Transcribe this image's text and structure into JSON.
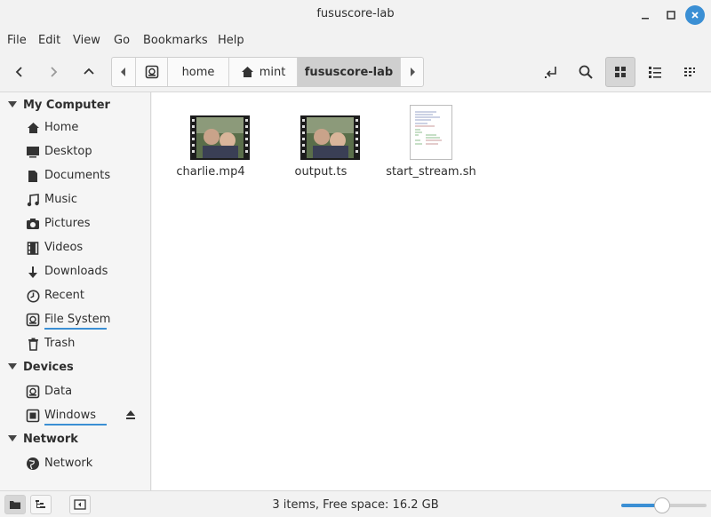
{
  "window": {
    "title": "fususcore-lab"
  },
  "menu": [
    "File",
    "Edit",
    "View",
    "Go",
    "Bookmarks",
    "Help"
  ],
  "breadcrumbs": [
    {
      "label": ""
    },
    {
      "label": "home"
    },
    {
      "label": "mint"
    },
    {
      "label": "fususcore-lab"
    }
  ],
  "sidebar": {
    "sections": [
      {
        "label": "My Computer"
      },
      {
        "label": "Devices"
      },
      {
        "label": "Network"
      }
    ],
    "items": [
      {
        "label": "Home",
        "icon": "home-icon"
      },
      {
        "label": "Desktop",
        "icon": "desktop-icon"
      },
      {
        "label": "Documents",
        "icon": "document-icon"
      },
      {
        "label": "Music",
        "icon": "music-icon"
      },
      {
        "label": "Pictures",
        "icon": "camera-icon"
      },
      {
        "label": "Videos",
        "icon": "film-icon"
      },
      {
        "label": "Downloads",
        "icon": "download-icon"
      },
      {
        "label": "Recent",
        "icon": "clock-icon"
      },
      {
        "label": "File System",
        "icon": "drive-icon"
      },
      {
        "label": "Trash",
        "icon": "trash-icon"
      },
      {
        "label": "Data",
        "icon": "drive-icon"
      },
      {
        "label": "Windows",
        "icon": "chip-icon"
      },
      {
        "label": "Network",
        "icon": "globe-icon"
      }
    ]
  },
  "files": [
    {
      "name": "charlie.mp4",
      "type": "video"
    },
    {
      "name": "output.ts",
      "type": "video"
    },
    {
      "name": "start_stream.sh",
      "type": "script"
    }
  ],
  "status": {
    "text": "3 items, Free space: 16.2 GB",
    "zoom_fraction": 0.48
  },
  "colors": {
    "accent": "#3b8fd4",
    "selected": "#cfcfcf"
  }
}
